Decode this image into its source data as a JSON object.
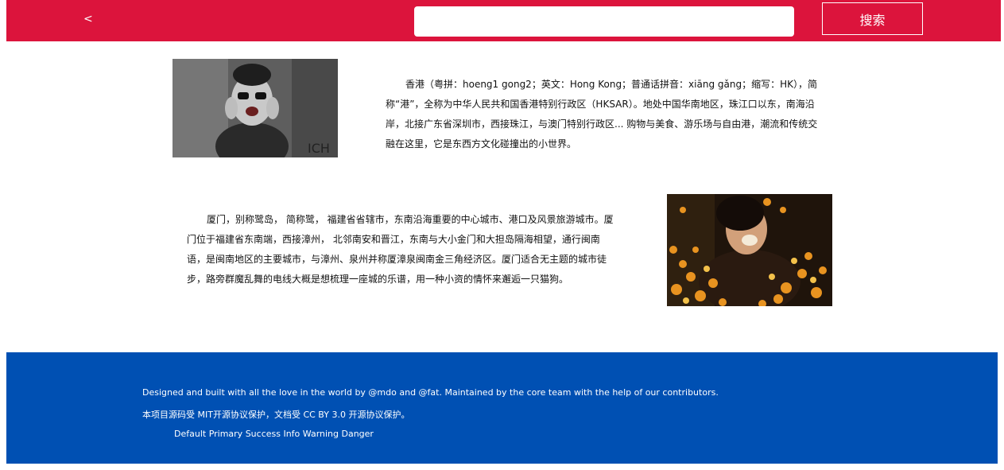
{
  "header": {
    "back_label": "<",
    "search": {
      "value": "",
      "placeholder": ""
    },
    "search_button_label": "搜索"
  },
  "articles": [
    {
      "text": "香港（粤拼：hoeng1 gong2；英文：Hong Kong；普通话拼音：xiāng gǎng；缩写：HK），简称“港”，全称为中华人民共和国香港特别行政区（HKSAR）。地处中国华南地区，珠江口以东，南海沿岸，北接广东省深圳市，西接珠江，与澳门特别行政区... 购物与美食、游乐场与自由港，潮流和传统交融在这里，它是东西方文化碰撞出的小世界。"
    },
    {
      "text": "厦门，别称鹭岛， 简称鹭， 福建省省辖市，东南沿海重要的中心城市、港口及风景旅游城市。厦门位于福建省东南端，西接漳州， 北邻南安和晋江，东南与大小金门和大担岛隔海相望，通行闽南语，是闽南地区的主要城市，与漳州、泉州并称厦漳泉闽南金三角经济区。厦门适合无主题的城市徒步，路旁群魔乱舞的电线大概是想梳理一座城的乐谱，用一种小资的情怀来邂逅一只猫狗。"
    }
  ],
  "footer": {
    "line1": "Designed and built with all the love in the world by @mdo and @fat. Maintained by the core team with the help of our contributors.",
    "line2": "本项目源码受 MIT开源协议保护，文档受 CC BY 3.0 开源协议保护。",
    "line3": "Default Primary Success Info Warning Danger"
  },
  "colors": {
    "header_bg": "#dc143c",
    "footer_bg": "#0050b3"
  }
}
